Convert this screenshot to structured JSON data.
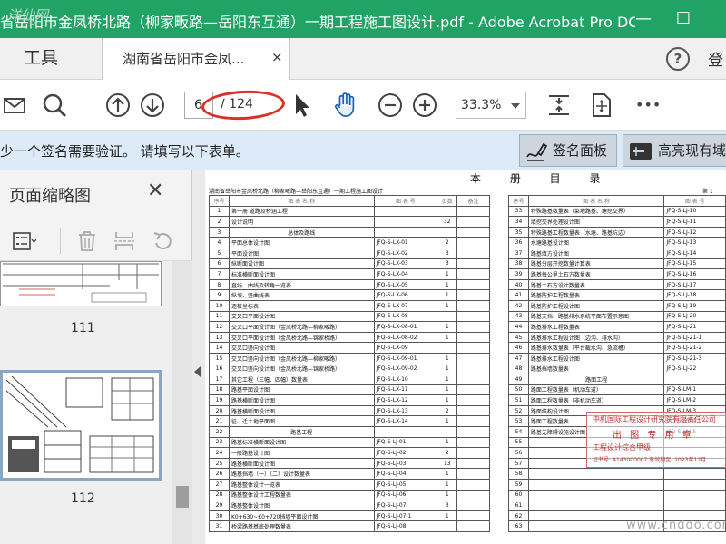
{
  "app": {
    "title": "省岳阳市金凤桥北路（柳家畈路—岳阳东互通）一期工程施工图设计.pdf - Adobe Acrobat Pro DC",
    "watermark_corner": "洋仙网",
    "minimize": "—",
    "maximize": "☐"
  },
  "tabs": {
    "tools": "工具",
    "doc": "湖南省岳阳市金凤...",
    "doc_close": "×",
    "help": "?",
    "login": "登"
  },
  "toolbar": {
    "page_current": "6",
    "page_total": "/ 124",
    "zoom": "33.3%",
    "more": "•••"
  },
  "notify": {
    "message": "少一个签名需要验证。 请填写以下表单。",
    "signature_panel": "签名面板",
    "highlight_fields": "高亮现有域"
  },
  "sidebar": {
    "title": "页面缩略图",
    "close": "✕",
    "page_labels": [
      "111",
      "112"
    ]
  },
  "doc": {
    "title": "本 册 目 录",
    "header": "湖南省岳阳市金凤桥北路（柳家畈路—岳阳东互通）一期工程施工图设计",
    "page_no": "第 1",
    "col_headers_left": [
      "序号",
      "图 表 名 称",
      "图 表 号",
      "页数",
      "备注"
    ],
    "col_headers_right": [
      "序号",
      "图 表 名 称",
      "图 表 号"
    ],
    "left_rows": [
      [
        "1",
        "第一册 道路及桥涵工程",
        "",
        ""
      ],
      [
        "2",
        "设计说明",
        "",
        "32"
      ],
      [
        "3",
        "总体及路线",
        "",
        ""
      ],
      [
        "4",
        "平面总体设计图",
        "JFQ-S-LX-01",
        "2"
      ],
      [
        "5",
        "平面设计图",
        "JFQ-S-LX-02",
        "3"
      ],
      [
        "6",
        "纵断面设计图",
        "JFQ-S-LX-03",
        "3"
      ],
      [
        "7",
        "标准横断面设计图",
        "JFQ-S-LX-04",
        "1"
      ],
      [
        "8",
        "直线、曲线及转角一览表",
        "JFQ-S-LX-05",
        "1"
      ],
      [
        "9",
        "纵坡、竖曲线表",
        "JFQ-S-LX-06",
        "1"
      ],
      [
        "10",
        "逐桩坐标表",
        "JFQ-S-LX-07",
        "1"
      ],
      [
        "11",
        "交叉口平面设计图",
        "JFQ-S-LX-08",
        ""
      ],
      [
        "12",
        "交叉口平面设计图（金凤桥北路—柳家畈路）",
        "JFQ-S-LX-08-01",
        "1"
      ],
      [
        "13",
        "交叉口平面设计图（金凤桥北路—锦家桥路）",
        "JFQ-S-LX-08-02",
        "1"
      ],
      [
        "14",
        "交叉口竖向设计图",
        "JFQ-S-LX-09",
        ""
      ],
      [
        "15",
        "交叉口竖向设计图（金凤桥北路—柳家畈路）",
        "JFQ-S-LX-09-01",
        "1"
      ],
      [
        "16",
        "交叉口竖向设计图（金凤桥北路—锦家桥路）",
        "JFQ-S-LX-09-02",
        "1"
      ],
      [
        "17",
        "其它工程（三幅、四幅）数量表",
        "JFQ-S-LX-10",
        "1"
      ],
      [
        "18",
        "路基平面设计图",
        "JFQ-S-LX-11",
        "1"
      ],
      [
        "19",
        "路基横断面设计图",
        "JFQ-S-LX-12",
        "1"
      ],
      [
        "20",
        "路基横断面设计图",
        "JFQ-S-LX-13",
        "2"
      ],
      [
        "21",
        "征、迁土地平面图",
        "JFQ-S-LX-14",
        "1"
      ],
      [
        "22",
        "路基工程",
        "",
        ""
      ],
      [
        "23",
        "路基标准横断面设计图",
        "JFQ-S-LJ-01",
        "1"
      ],
      [
        "24",
        "一般路基设计图",
        "JFQ-S-LJ-02",
        "2"
      ],
      [
        "25",
        "路基横断面设计图",
        "JFQ-S-LJ-03",
        "13"
      ],
      [
        "26",
        "路基挡墙（一）（二）设计数量表",
        "JFQ-S-LJ-04",
        "1"
      ],
      [
        "27",
        "路基整体设计一览表",
        "JFQ-S-LJ-05",
        "1"
      ],
      [
        "28",
        "路基整体设计工程数量表",
        "JFQ-S-LJ-06",
        "1"
      ],
      [
        "29",
        "路基整体设计图",
        "JFQ-S-LJ-07",
        "3"
      ],
      [
        "30",
        "K0+630~K0+720挡墙平面设计图",
        "JFQ-S-LJ-07-1",
        "1"
      ],
      [
        "31",
        "桥梁路基基底处理数量表",
        "JFQ-S-LJ-08",
        ""
      ]
    ],
    "right_rows": [
      [
        "33",
        "特殊路基数量表（菜地路基、塘挖交界）",
        "JFQ-S-LJ-10"
      ],
      [
        "34",
        "填挖交界处理设计图",
        "JFQ-S-LJ-11"
      ],
      [
        "35",
        "特殊路基工程数量表（水塘、路基坑边）",
        "JFQ-S-LJ-12"
      ],
      [
        "36",
        "水塘路基设计图",
        "JFQ-S-LJ-13"
      ],
      [
        "37",
        "路基填方设计图",
        "JFQ-S-LJ-14"
      ],
      [
        "38",
        "路基分层开挖数量计算表",
        "JFQ-S-LJ-15"
      ],
      [
        "39",
        "路基每公里土石方数量表",
        "JFQ-S-LJ-16"
      ],
      [
        "40",
        "路基土石方设计数量表",
        "JFQ-S-LJ-17"
      ],
      [
        "41",
        "路基防护工程数量表",
        "JFQ-S-LJ-18"
      ],
      [
        "42",
        "路基防护工程设计图",
        "JFQ-S-LJ-19"
      ],
      [
        "43",
        "路基支挡、路基排水系统平面布置示意图",
        "JFQ-S-LJ-20"
      ],
      [
        "44",
        "路基排水工程数量表",
        "JFQ-S-LJ-21"
      ],
      [
        "45",
        "路基排水工程设计图（边沟、排水沟）",
        "JFQ-S-LJ-21-1"
      ],
      [
        "46",
        "路基排水数量表（平台截水沟、急流槽）",
        "JFQ-S-LJ-21-2"
      ],
      [
        "47",
        "路基排水工程设计图",
        "JFQ-S-LJ-21-3"
      ],
      [
        "48",
        "路基挡墙数量表",
        "JFQ-S-LJ-22"
      ],
      [
        "49",
        "路面工程",
        ""
      ],
      [
        "50",
        "路面工程数量表（机动车道）",
        "JFQ-S-LM-1"
      ],
      [
        "51",
        "路面工程数量表（非机动车道）",
        "JFQ-S-LM-2"
      ],
      [
        "52",
        "路面结构设计图",
        "JFQ-S-LM-3"
      ],
      [
        "53",
        "路面工程数量表",
        "JFQ-S-LM-4"
      ],
      [
        "54",
        "路基无障碍设施设计图",
        "JFQ-S-LM-5"
      ],
      [
        "55",
        "",
        ""
      ],
      [
        "56",
        "",
        ""
      ],
      [
        "57",
        "",
        ""
      ],
      [
        "58",
        "",
        ""
      ],
      [
        "59",
        "",
        ""
      ],
      [
        "60",
        "",
        ""
      ],
      [
        "61",
        "",
        ""
      ],
      [
        "62",
        "",
        ""
      ],
      [
        "63",
        "",
        ""
      ]
    ],
    "stamp_lines": [
      "中机国际工程设计研究院有限责任公司",
      "出 图 专 用 章",
      "工程设计综合甲级",
      "证书号: A143000007   有效期至: 2023年12月"
    ],
    "watermark": "www.cnddo.com"
  }
}
